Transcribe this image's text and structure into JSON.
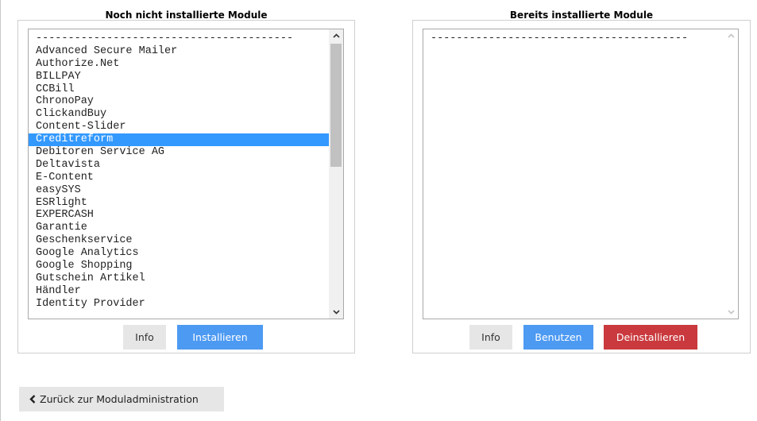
{
  "not_installed": {
    "title": "Noch nicht installierte Module",
    "items": [
      "----------------------------------------",
      "Advanced Secure Mailer",
      "Authorize.Net",
      "BILLPAY",
      "CCBill",
      "ChronoPay",
      "ClickandBuy",
      "Content-Slider",
      "Creditreform",
      "Debitoren Service AG",
      "Deltavista",
      "E-Content",
      "easySYS",
      "ESRlight",
      "EXPERCASH",
      "Garantie",
      "Geschenkservice",
      "Google Analytics",
      "Google Shopping",
      "Gutschein Artikel",
      "Händler",
      "Identity Provider"
    ],
    "selected_index": 8,
    "info_label": "Info",
    "install_label": "Installieren"
  },
  "installed": {
    "title": "Bereits installierte Module",
    "items": [
      "----------------------------------------"
    ],
    "info_label": "Info",
    "use_label": "Benutzen",
    "uninstall_label": "Deinstallieren"
  },
  "back_label": "Zurück zur Moduladministration",
  "icons": {
    "scroll_up": "chevron-up-icon",
    "scroll_down": "chevron-down-icon",
    "back": "chevron-left-icon"
  },
  "colors": {
    "selection": "#3399ff",
    "primary": "#4d9af2",
    "danger": "#c9393d",
    "default": "#e6e6e6"
  }
}
